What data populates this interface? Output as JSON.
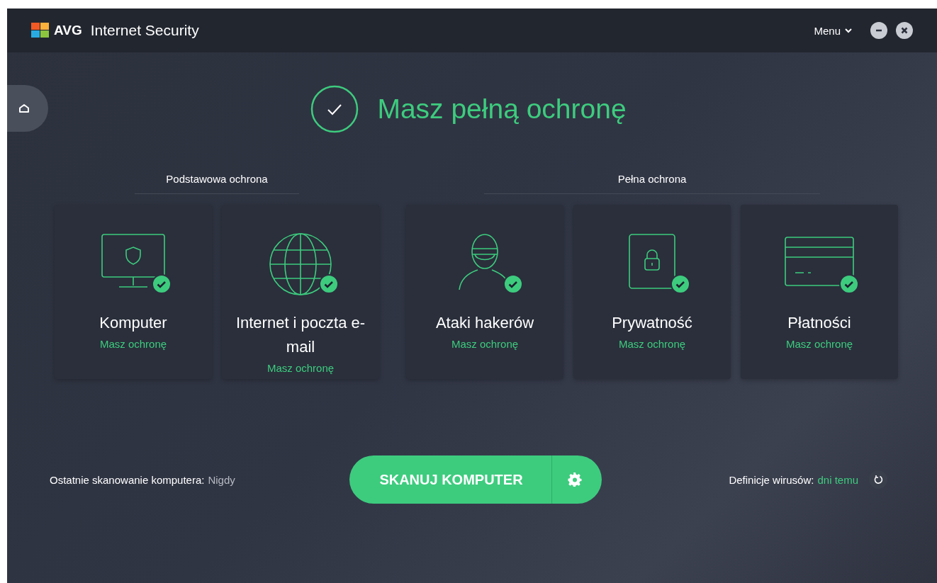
{
  "window": {
    "logo": "AVG",
    "title": "Internet Security",
    "menu": "Menu"
  },
  "status": {
    "title": "Masz pełną ochronę",
    "protected": true
  },
  "groups": [
    {
      "heading": "Podstawowa ochrona",
      "cards": [
        {
          "kind": "computer",
          "title": "Komputer",
          "status": "Masz ochronę",
          "protected": true
        },
        {
          "kind": "web",
          "title": "Internet i poczta e-mail",
          "status": "Masz ochronę",
          "protected": true
        }
      ]
    },
    {
      "heading": "Pełna ochrona",
      "cards": [
        {
          "kind": "hacker",
          "title": "Ataki hakerów",
          "status": "Masz ochronę",
          "protected": true
        },
        {
          "kind": "privacy",
          "title": "Prywatność",
          "status": "Masz ochronę",
          "protected": true
        },
        {
          "kind": "payments",
          "title": "Płatności",
          "status": "Masz ochronę",
          "protected": true
        }
      ]
    }
  ],
  "footer": {
    "last_scan_label": "Ostatnie skanowanie komputera:",
    "last_scan_value": "Nigdy",
    "scan_button": "SKANUJ KOMPUTER",
    "definitions_label": "Definicje wirusów:",
    "definitions_value": "dni temu"
  }
}
